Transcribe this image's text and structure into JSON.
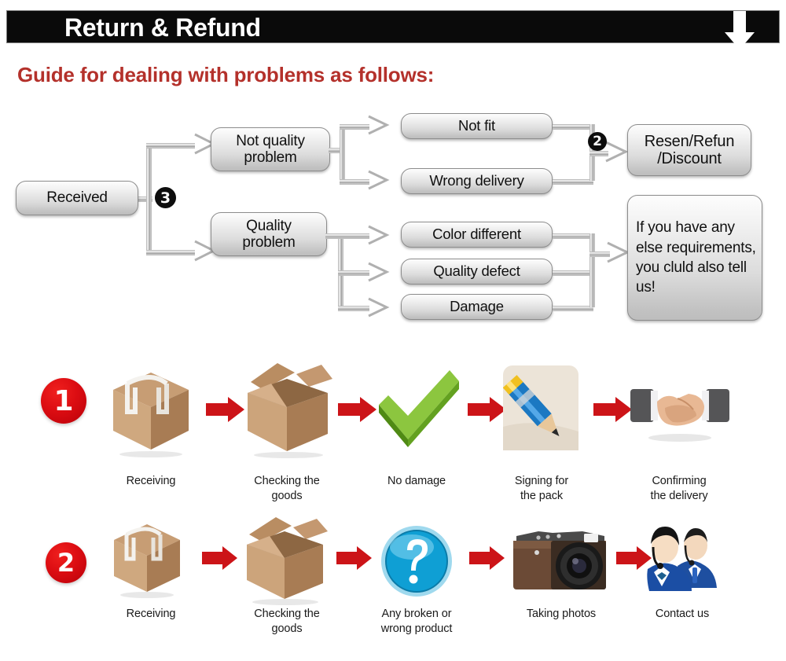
{
  "header": {
    "title": "Return & Refund",
    "arrow_icon": "down-arrow-icon"
  },
  "guide": {
    "title": "Guide for dealing with problems as follows:"
  },
  "flowchart": {
    "nodes": {
      "received": "Received",
      "not_quality_problem": "Not quality\nproblem",
      "quality_problem": "Quality\nproblem",
      "not_fit": "Not fit",
      "wrong_delivery": "Wrong delivery",
      "color_different": "Color different",
      "quality_defect": "Quality defect",
      "damage": "Damage",
      "resend_refund": "Resen/Refun\n/Discount",
      "any_else": "If you have any else requirements, you cluld also tell us!"
    },
    "badges": {
      "three": "3",
      "two": "2"
    }
  },
  "steps": {
    "row1": {
      "badge": "1",
      "items": [
        {
          "icon": "closed-box-icon",
          "label": "Receiving"
        },
        {
          "icon": "open-box-icon",
          "label": "Checking the\ngoods"
        },
        {
          "icon": "green-check-icon",
          "label": "No damage"
        },
        {
          "icon": "pencil-signing-icon",
          "label": "Signing for\nthe pack"
        },
        {
          "icon": "handshake-icon",
          "label": "Confirming\nthe delivery"
        }
      ]
    },
    "row2": {
      "badge": "2",
      "items": [
        {
          "icon": "closed-box-icon",
          "label": "Receiving"
        },
        {
          "icon": "open-box-icon",
          "label": "Checking the\ngoods"
        },
        {
          "icon": "question-mark-icon",
          "label": "Any broken or\nwrong product"
        },
        {
          "icon": "camera-icon",
          "label": "Taking photos"
        },
        {
          "icon": "support-agents-icon",
          "label": "Contact us"
        }
      ]
    },
    "arrow_icon": "red-right-arrow-icon"
  },
  "colors": {
    "header_bg": "#0a0a0a",
    "header_text": "#ffffff",
    "guide_title": "#b4312b",
    "red_arrow": "#cc1418",
    "red_badge": "#d80d12",
    "box_border": "#8c8c8c",
    "connector": "#bcbcbc",
    "check_green": "#77b82a",
    "question_blue": "#1aa8da"
  }
}
